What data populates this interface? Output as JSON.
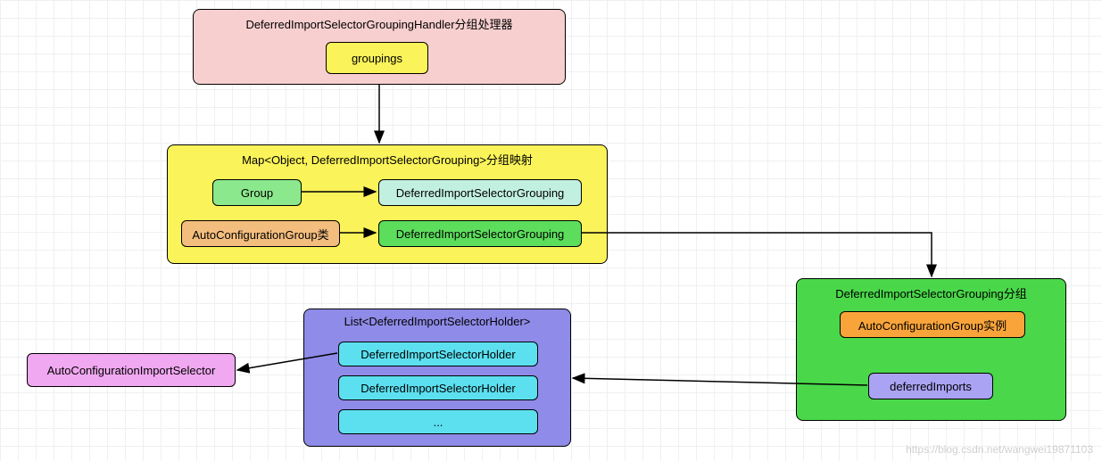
{
  "nodes": {
    "handler": {
      "title": "DeferredImportSelectorGroupingHandler分组处理器",
      "groupings": "groupings"
    },
    "map": {
      "title": "Map<Object, DeferredImportSelectorGrouping>分组映射",
      "group_key": "Group",
      "group_val": "DeferredImportSelectorGrouping",
      "auto_key": "AutoConfigurationGroup类",
      "auto_val": "DeferredImportSelectorGrouping"
    },
    "grouping": {
      "title": "DeferredImportSelectorGrouping分组",
      "instance": "AutoConfigurationGroup实例",
      "deferred": "deferredImports"
    },
    "list": {
      "title": "List<DeferredImportSelectorHolder>",
      "item1": "DeferredImportSelectorHolder",
      "item2": "DeferredImportSelectorHolder",
      "item3": "..."
    },
    "selector": "AutoConfigurationImportSelector"
  },
  "watermark": "https://blog.csdn.net/wangwei19871103"
}
